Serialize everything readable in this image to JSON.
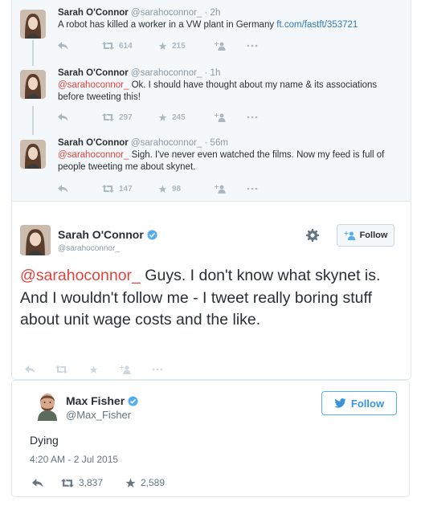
{
  "conversation": [
    {
      "name": "Sarah O'Connor",
      "handle": "@sarahoconnor_",
      "time": "· 2h",
      "text": "A robot has killed a worker in a VW plant in Germany ",
      "link": "ft.com/fastft/353721",
      "retweets": "614",
      "favorites": "215"
    },
    {
      "name": "Sarah O'Connor",
      "handle": "@sarahoconnor_",
      "time": "· 1h",
      "mention": "@sarahoconnor_",
      "text": " Ok. I should have thought about my name & its associations before tweeting this!",
      "retweets": "297",
      "favorites": "245"
    },
    {
      "name": "Sarah O'Connor",
      "handle": "@sarahoconnor_",
      "time": "· 56m",
      "mention": "@sarahoconnor_",
      "text": " Sigh. I've never even watched the films. Now my feed is full of people tweeting me about skynet.",
      "retweets": "147",
      "favorites": "98"
    }
  ],
  "main_tweet": {
    "name": "Sarah O'Connor",
    "handle": "@sarahoconnor_",
    "follow_label": "Follow",
    "mention": "@sarahoconnor_",
    "text": " Guys. I don't know what skynet is. And I wouldn't follow me - I tweet really boring stuff about unit wage costs and the like."
  },
  "quoted_tweet": {
    "name": "Max Fisher",
    "handle": "@Max_Fisher",
    "follow_label": "Follow",
    "text": "Dying",
    "date": "4:20 AM - 2 Jul 2015",
    "retweets": "3,837",
    "favorites": "2,589"
  },
  "colors": {
    "link": "#2b7bb9",
    "mention": "#e0443d",
    "verified": "#55acee",
    "muted": "#8899a6",
    "conversation_bg": "#f5f8fa"
  },
  "icons": [
    "reply-icon",
    "retweet-icon",
    "favorite-icon",
    "follow-icon",
    "more-icon",
    "gear-icon",
    "verified-badge-icon",
    "bird-icon"
  ]
}
